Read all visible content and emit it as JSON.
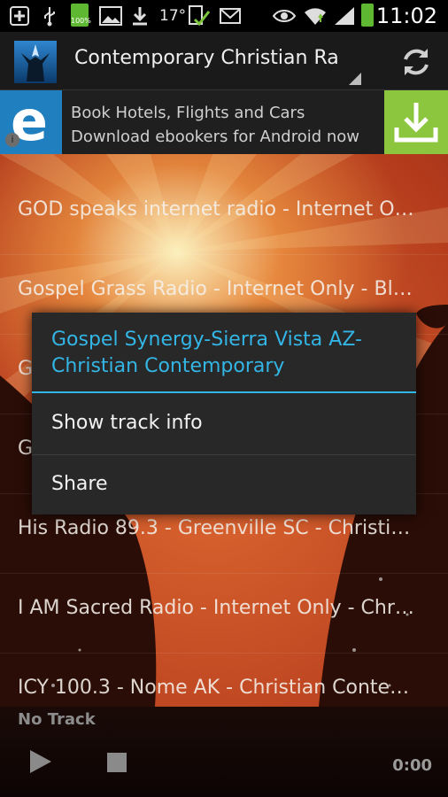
{
  "status_bar": {
    "battery_percent_label": "100%",
    "temperature": "17°",
    "time": "11:02",
    "icons": [
      "add-icon",
      "usb-icon",
      "battery-full-icon",
      "image-icon",
      "download-icon",
      "weather-icon",
      "check-icon",
      "gmail-icon",
      "eye-icon",
      "wifi-icon",
      "signal-icon",
      "battery-icon"
    ]
  },
  "action_bar": {
    "title": "Contemporary Christian Rad..",
    "refresh_icon": "refresh-icon"
  },
  "ad": {
    "logo_letter": "e",
    "text": "Book Hotels, Flights and Cars Download ebookers for Android now",
    "info_label": "i",
    "download_icon": "download-icon",
    "colors": {
      "logo_bg": "#1f7fbf",
      "download_bg": "#8cc63e"
    }
  },
  "stations": [
    "GOD speaks internet radio - Internet On..",
    "Gospel Grass Radio - Internet Only - Blu..",
    "G",
    "G",
    "His Radio 89.3 - Greenville SC - Christian..",
    "I AM Sacred Radio - Internet Only - Chris..",
    "ICY 100.3 - Nome AK - Christian Contem.."
  ],
  "dialog": {
    "title": "Gospel Synergy-Sierra Vista AZ-Christian Contemporary",
    "items": [
      "Show track info",
      "Share"
    ],
    "accent_color": "#33b5e5"
  },
  "player": {
    "track": "No Track",
    "time": "0:00",
    "play_icon": "play-icon",
    "stop_icon": "stop-icon"
  }
}
